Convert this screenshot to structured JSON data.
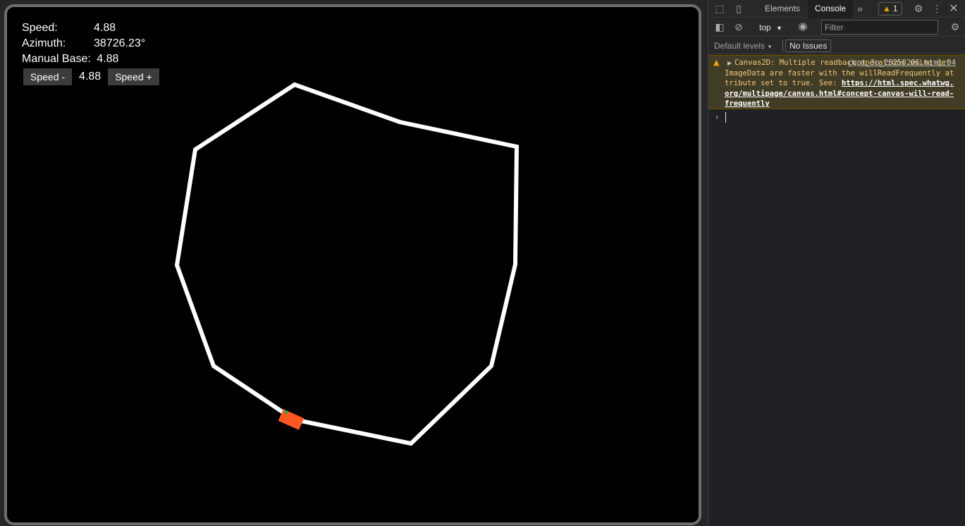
{
  "hud": {
    "speed_label": "Speed:",
    "speed_value": "4.88",
    "azimuth_label": "Azimuth:",
    "azimuth_value": "38726.23°",
    "manual_base_label": "Manual Base:",
    "manual_base_value": "4.88",
    "speed_minus_label": "Speed -",
    "speed_display": "4.88",
    "speed_plus_label": "Speed +"
  },
  "track": {
    "color": "#ffffff",
    "car_color": "#ff5722",
    "car_marker_color": "#22aa44",
    "background": "#000000"
  },
  "devtools": {
    "tabs": [
      {
        "label": "Elements",
        "active": false
      },
      {
        "label": "Console",
        "active": true
      }
    ],
    "warning_count": "1",
    "context": "top",
    "filter_placeholder": "Filter",
    "levels_label": "Default levels",
    "issues_label": "No Issues",
    "warning": {
      "source": "cgpt_3o_20250206.html:94",
      "message": "Canvas2D: Multiple readback operations using getImageData are faster with the willReadFrequently attribute set to true. See: ",
      "link": "https://html.spec.whatwg.org/multipage/canvas.html#concept-canvas-will-read-frequently"
    },
    "prompt": "›"
  }
}
